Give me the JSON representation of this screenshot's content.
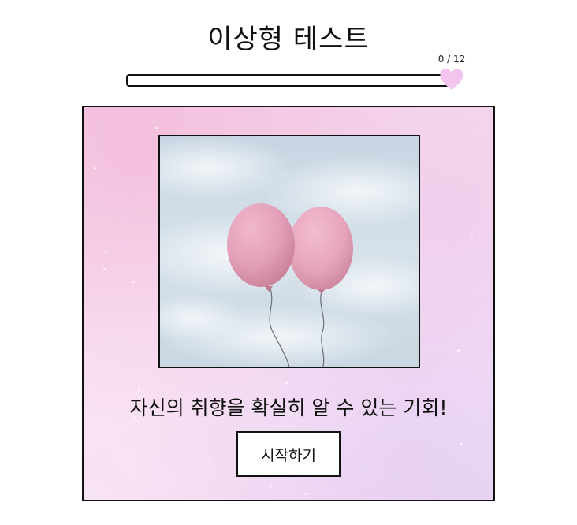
{
  "header": {
    "title": "이상형 테스트"
  },
  "progress": {
    "label": "0 / 12",
    "current": 0,
    "total": 12,
    "fill_color": "#f3c7ec",
    "marker_icon": "heart-icon",
    "marker_color": "#f2c4ee"
  },
  "card": {
    "image": "pink-balloons-in-cloudy-sky",
    "caption": "자신의 취향을 확실히 알 수 있는 기회!",
    "start_label": "시작하기"
  },
  "colors": {
    "border": "#111111",
    "card_tint": "#f6d3e8",
    "balloon": "#e7a4be"
  }
}
